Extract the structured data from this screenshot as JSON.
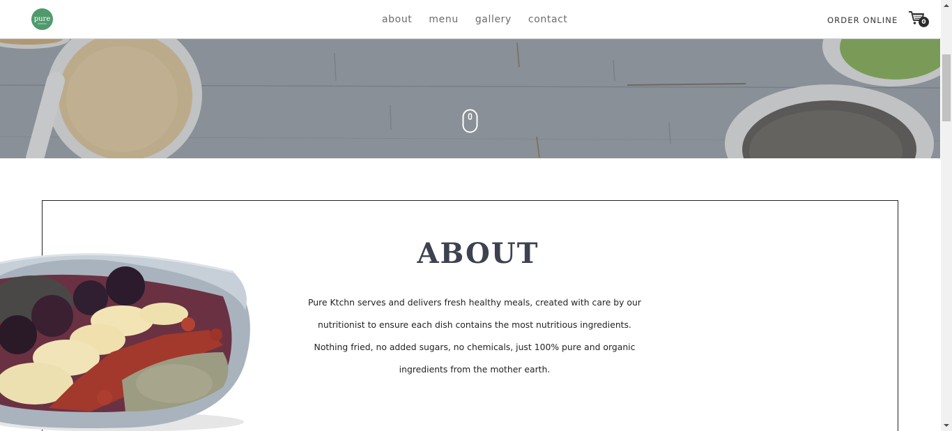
{
  "header": {
    "logo_text": "pure",
    "nav": [
      {
        "label": "about"
      },
      {
        "label": "menu"
      },
      {
        "label": "gallery"
      },
      {
        "label": "contact"
      }
    ],
    "order_online": "ORDER ONLINE",
    "cart_count": "0"
  },
  "about": {
    "title": "ABOUT",
    "lines": [
      "Pure Ktchn serves and delivers fresh healthy meals, created with care by our",
      "nutritionist to ensure each dish contains the most nutritious ingredients.",
      "Nothing fried, no added sugars, no chemicals, just 100% pure and organic",
      "ingredients from the mother earth."
    ]
  },
  "icons": {
    "logo": "pure-logo-icon",
    "cart": "shopping-cart-icon",
    "scroll": "mouse-scroll-icon",
    "scroll_up": "chevron-up-icon",
    "scroll_down": "chevron-down-icon"
  },
  "colors": {
    "brand_green": "#4f9a6c",
    "title": "#3e4150",
    "nav_text": "#6b6b6b",
    "hero_tint": "#8e949b"
  }
}
